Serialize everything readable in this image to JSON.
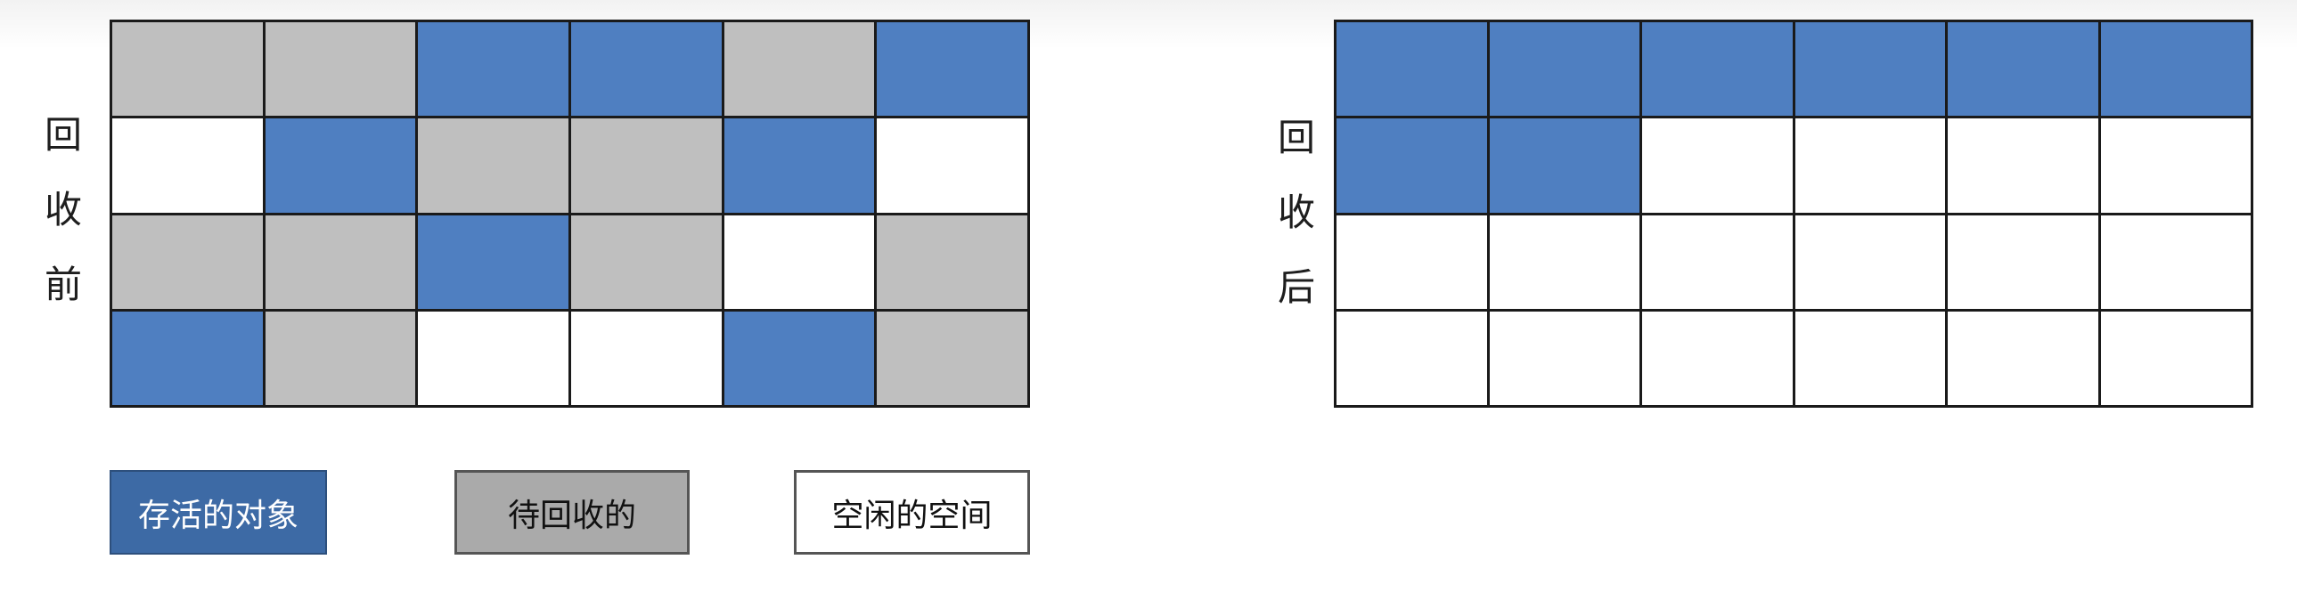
{
  "colors": {
    "live": "#4f7fc1",
    "garbage": "#bfbfbf",
    "free": "#ffffff"
  },
  "before": {
    "label": [
      "回",
      "收",
      "前"
    ],
    "cells": [
      [
        "garbage",
        "garbage",
        "live",
        "live",
        "garbage",
        "live"
      ],
      [
        "free",
        "live",
        "garbage",
        "garbage",
        "live",
        "free"
      ],
      [
        "garbage",
        "garbage",
        "live",
        "garbage",
        "free",
        "garbage"
      ],
      [
        "live",
        "garbage",
        "free",
        "free",
        "live",
        "garbage"
      ]
    ]
  },
  "after": {
    "label": [
      "回",
      "收",
      "后"
    ],
    "cells": [
      [
        "live",
        "live",
        "live",
        "live",
        "live",
        "live"
      ],
      [
        "live",
        "live",
        "free",
        "free",
        "free",
        "free"
      ],
      [
        "free",
        "free",
        "free",
        "free",
        "free",
        "free"
      ],
      [
        "free",
        "free",
        "free",
        "free",
        "free",
        "free"
      ]
    ]
  },
  "legend": {
    "live": "存活的对象",
    "garbage": "待回收的",
    "free": "空闲的空间"
  }
}
